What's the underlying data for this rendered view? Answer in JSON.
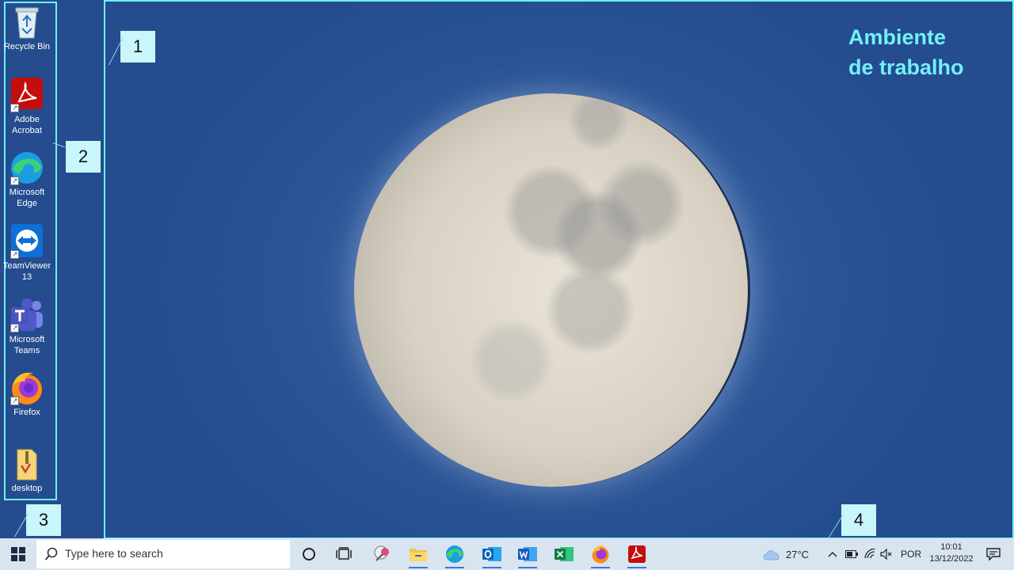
{
  "desktop": {
    "title_line1": "Ambiente",
    "title_line2": "de trabalho",
    "icons": [
      {
        "label_line1": "Recycle Bin",
        "label_line2": ""
      },
      {
        "label_line1": "Adobe",
        "label_line2": "Acrobat"
      },
      {
        "label_line1": "Microsoft",
        "label_line2": "Edge"
      },
      {
        "label_line1": "TeamViewer",
        "label_line2": "13"
      },
      {
        "label_line1": "Microsoft",
        "label_line2": "Teams"
      },
      {
        "label_line1": "Firefox",
        "label_line2": ""
      },
      {
        "label_line1": "desktop",
        "label_line2": ""
      }
    ]
  },
  "callouts": [
    "1",
    "2",
    "3",
    "4"
  ],
  "taskbar": {
    "search_placeholder": "Type here to search",
    "apps": [
      "cortana-icon",
      "task-view-icon",
      "snipping-icon",
      "file-explorer-icon",
      "edge-icon",
      "outlook-icon",
      "word-icon",
      "excel-icon",
      "firefox-icon",
      "acrobat-icon"
    ]
  },
  "tray": {
    "weather": "27°C",
    "language": "POR",
    "time": "10:01",
    "date": "13/12/2022"
  },
  "colors": {
    "highlight": "#6ff0f0",
    "callout_bg": "#c8f6fa",
    "title": "#73f0f8"
  }
}
